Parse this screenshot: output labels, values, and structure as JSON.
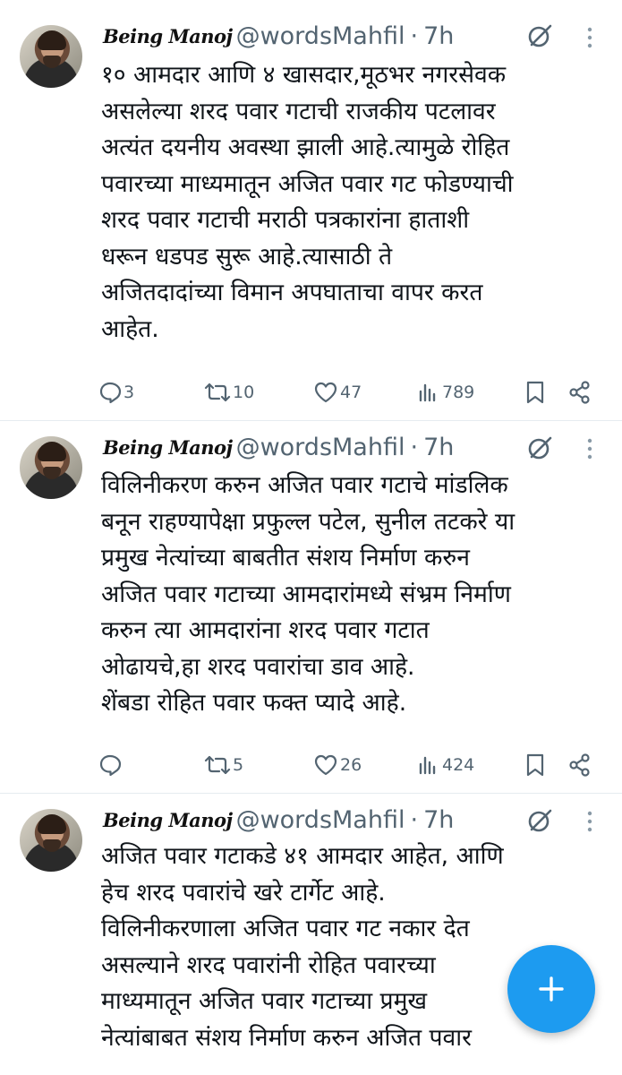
{
  "tweets": [
    {
      "name": "Being Manoj",
      "handle": "@wordsMahfil",
      "time": "7h",
      "text": "१० आमदार आणि ४ खासदार,मूठभर नगरसेवक\nअसलेल्या शरद पवार गटाची राजकीय पटलावर\nअत्यंत दयनीय अवस्था झाली आहे.त्यामुळे रोहित\nपवारच्या माध्यमातून अजित पवार गट फोडण्याची\nशरद पवार गटाची मराठी पत्रकारांना हाताशी\nधरून धडपड सुरू आहे.त्यासाठी ते\nअजितदादांच्या विमान अपघाताचा वापर करत\nआहेत.",
      "replies": "3",
      "reposts": "10",
      "likes": "47",
      "views": "789"
    },
    {
      "name": "Being Manoj",
      "handle": "@wordsMahfil",
      "time": "7h",
      "text": "विलिनीकरण करुन अजित पवार गटाचे मांडलिक\nबनून राहण्यापेक्षा प्रफुल्ल पटेल, सुनील तटकरे या\nप्रमुख नेत्यांच्या बाबतीत संशय निर्माण करुन\nअजित पवार गटाच्या आमदारांमध्ये संभ्रम निर्माण\nकरुन त्या आमदारांना शरद पवार गटात\nओढायचे,हा शरद पवारांचा डाव आहे.\nशेंबडा रोहित पवार फक्त प्यादे आहे.",
      "replies": "",
      "reposts": "5",
      "likes": "26",
      "views": "424"
    },
    {
      "name": "Being Manoj",
      "handle": "@wordsMahfil",
      "time": "7h",
      "text": "अजित पवार गटाकडे ४१ आमदार आहेत, आणि\nहेच शरद पवारांचे खरे टार्गेट आहे.\nविलिनीकरणाला अजित पवार गट नकार देत\nअसल्याने शरद पवारांनी रोहित पवारच्या\nमाध्यमातून अजित पवार गटाच्या प्रमुख\nनेत्यांबाबत संशय निर्माण करुन अजित पवार"
    }
  ],
  "separator": "·",
  "icons": {
    "reply": "reply-icon",
    "repost": "repost-icon",
    "like": "heart-icon",
    "views": "views-icon",
    "bookmark": "bookmark-icon",
    "share": "share-icon",
    "grok": "grok-icon",
    "more": "more-vertical-icon",
    "compose": "plus-icon"
  },
  "colors": {
    "accent": "#1d9bf0",
    "muted": "#536471",
    "text": "#0f1419",
    "divider": "#e6ecf0"
  }
}
